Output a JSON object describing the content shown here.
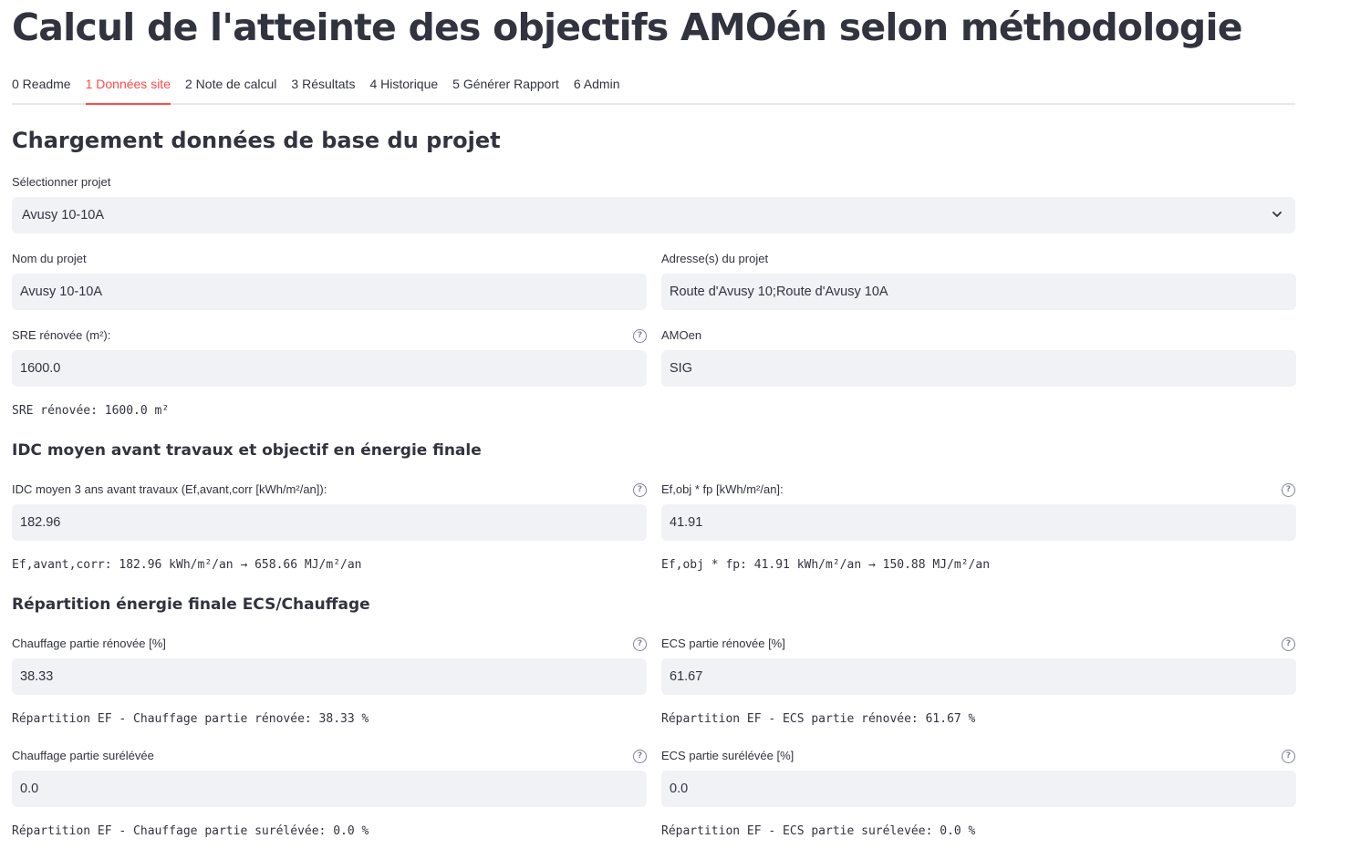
{
  "title": "Calcul de l'atteinte des objectifs AMOén selon méthodologie",
  "tabs": [
    {
      "label": "0 Readme",
      "active": false
    },
    {
      "label": "1 Données site",
      "active": true
    },
    {
      "label": "2 Note de calcul",
      "active": false
    },
    {
      "label": "3 Résultats",
      "active": false
    },
    {
      "label": "4 Historique",
      "active": false
    },
    {
      "label": "5 Générer Rapport",
      "active": false
    },
    {
      "label": "6 Admin",
      "active": false
    }
  ],
  "accent_color": "#ff4b4b",
  "section_title": "Chargement données de base du projet",
  "select_project": {
    "label": "Sélectionner projet",
    "value": "Avusy 10-10A"
  },
  "project_name": {
    "label": "Nom du projet",
    "value": "Avusy 10-10A"
  },
  "project_address": {
    "label": "Adresse(s) du projet",
    "value": "Route d'Avusy 10;Route d'Avusy 10A"
  },
  "sre": {
    "label": "SRE rénovée (m²):",
    "value": "1600.0",
    "summary": "SRE rénovée: 1600.0 m²"
  },
  "amoen": {
    "label": "AMOen",
    "value": "SIG"
  },
  "idc_section": "IDC moyen avant travaux et objectif en énergie finale",
  "idc": {
    "label": "IDC moyen 3 ans avant travaux (Ef,avant,corr [kWh/m²/an]):",
    "value": "182.96",
    "summary": "Ef,avant,corr: 182.96 kWh/m²/an → 658.66 MJ/m²/an"
  },
  "ef_obj": {
    "label": "Ef,obj * fp [kWh/m²/an]:",
    "value": "41.91",
    "summary": "Ef,obj * fp: 41.91 kWh/m²/an → 150.88 MJ/m²/an"
  },
  "repartition_section": "Répartition énergie finale ECS/Chauffage",
  "chauffage_renovee": {
    "label": "Chauffage partie rénovée [%]",
    "value": "38.33",
    "summary": "Répartition EF - Chauffage partie rénovée: 38.33 %"
  },
  "ecs_renovee": {
    "label": "ECS partie rénovée [%]",
    "value": "61.67",
    "summary": "Répartition EF - ECS partie rénovée: 61.67 %"
  },
  "chauffage_surelevee": {
    "label": "Chauffage partie surélévée",
    "value": "0.0",
    "summary": "Répartition EF - Chauffage partie surélévée: 0.0 %"
  },
  "ecs_surelevee": {
    "label": "ECS partie surélévée [%]",
    "value": "0.0",
    "summary": "Répartition EF - ECS partie surélevée: 0.0 %"
  },
  "icons": {
    "help": "help-circle-icon",
    "dropdown": "chevron-down-icon"
  }
}
